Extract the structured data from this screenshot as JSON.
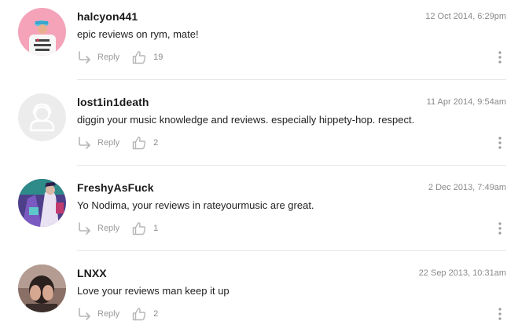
{
  "comments": [
    {
      "username": "halcyon441",
      "timestamp": "12 Oct 2014, 6:29pm",
      "text": "epic reviews on rym, mate!",
      "reply_label": "Reply",
      "likes": "19",
      "avatar": "pink-background-t-shirt-photo",
      "avatar_color": "#f4a3b9"
    },
    {
      "username": "lost1in1death",
      "timestamp": "11 Apr 2014, 9:54am",
      "text": "diggin your music knowledge and reviews. especially hippety-hop. respect.",
      "reply_label": "Reply",
      "likes": "2",
      "avatar": "default-user-placeholder",
      "avatar_color": "#ececec"
    },
    {
      "username": "FreshyAsFuck",
      "timestamp": "2 Dec 2013, 7:49am",
      "text": "Yo Nodima, your reviews in rateyourmusic are great.",
      "reply_label": "Reply",
      "likes": "1",
      "avatar": "anime-illustration",
      "avatar_color": "#6a5aa8"
    },
    {
      "username": "LNXX",
      "timestamp": "22 Sep 2013, 10:31am",
      "text": "Love your reviews man keep it up",
      "reply_label": "Reply",
      "likes": "2",
      "avatar": "person-covering-face-photo",
      "avatar_color": "#a07a6a"
    }
  ],
  "icons": {
    "reply": "reply-arrow-icon",
    "like": "thumbs-up-icon",
    "more": "more-vertical-icon"
  }
}
